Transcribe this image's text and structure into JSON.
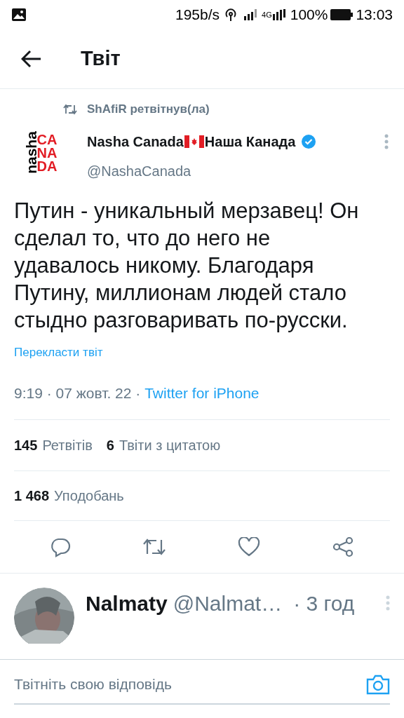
{
  "status_bar": {
    "speed": "195b/s",
    "network": "4G",
    "battery": "100%",
    "time": "13:03"
  },
  "header": {
    "title": "Твіт"
  },
  "retweet": {
    "text": "ShAfiR ретвітнув(ла)"
  },
  "author": {
    "avatar": {
      "vertical": "nasha",
      "lines": [
        "CA",
        "NA",
        "DA"
      ]
    },
    "name_parts": [
      "Nasha Canada",
      "Наша Канада"
    ],
    "verified": true,
    "handle": "@NashaCanada"
  },
  "tweet": {
    "text": "Путин - уникальный мерзавец! Он сделал то, что до него не удавалось никому. Благодаря Путину, миллионам людей стало стыдно разговаривать по-русски.",
    "translate": "Перекласти твіт",
    "time": "9:19 · 07 жовт. 22 · ",
    "source": "Twitter for iPhone"
  },
  "stats": [
    {
      "count": "145",
      "label": "Ретвітів"
    },
    {
      "count": "6",
      "label": "Твіти з цитатою"
    }
  ],
  "likes": {
    "count": "1 468",
    "label": "Уподобань"
  },
  "reply": {
    "name": "Nalmaty",
    "handle": "@Nalmat…",
    "time": "· 3 год"
  },
  "compose": {
    "placeholder": "Твітніть свою відповідь"
  }
}
